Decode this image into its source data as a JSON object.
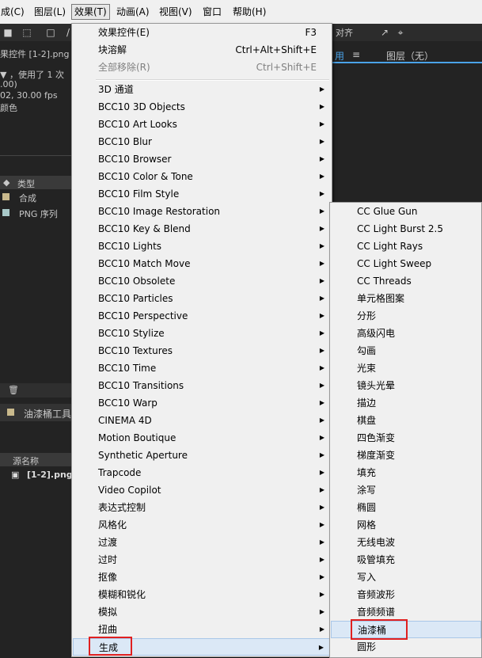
{
  "menubar": {
    "items": [
      "成(C)",
      "图层(L)",
      "效果(T)",
      "动画(A)",
      "视图(V)",
      "窗口",
      "帮助(H)"
    ],
    "active_index": 2
  },
  "toolbar": {
    "right_text": "对齐"
  },
  "left_panel": {
    "title": "果控件 [1-2].png",
    "info_line1": "▼ ，使用了 1 次",
    "info_line2": ".00)",
    "info_line3": "02, 30.00 fps",
    "info_line4": "颜色",
    "type_header": "类型",
    "row1": "合成",
    "row2": "PNG 序列",
    "comp_tab": "油漆桶工具",
    "source_header": "源名称",
    "source_row": "[1-2].png"
  },
  "right_panel": {
    "tab_label": "用",
    "layer_label": "图层（无）"
  },
  "main_menu": {
    "top_items": [
      {
        "label": "效果控件(E)",
        "shortcut": "F3",
        "disabled": false
      },
      {
        "label": "块溶解",
        "shortcut": "Ctrl+Alt+Shift+E",
        "disabled": false
      },
      {
        "label": "全部移除(R)",
        "shortcut": "Ctrl+Shift+E",
        "disabled": true
      }
    ],
    "submenu_items": [
      "3D 通道",
      "BCC10 3D Objects",
      "BCC10 Art Looks",
      "BCC10 Blur",
      "BCC10 Browser",
      "BCC10 Color & Tone",
      "BCC10 Film Style",
      "BCC10 Image Restoration",
      "BCC10 Key & Blend",
      "BCC10 Lights",
      "BCC10 Match Move",
      "BCC10 Obsolete",
      "BCC10 Particles",
      "BCC10 Perspective",
      "BCC10 Stylize",
      "BCC10 Textures",
      "BCC10 Time",
      "BCC10 Transitions",
      "BCC10 Warp",
      "CINEMA 4D",
      "Motion Boutique",
      "Synthetic Aperture",
      "Trapcode",
      "Video Copilot",
      "表达式控制",
      "风格化",
      "过渡",
      "过时",
      "抠像",
      "模糊和锐化",
      "模拟",
      "扭曲",
      "生成"
    ],
    "highlighted_label": "生成"
  },
  "generate_submenu": {
    "items": [
      "CC Glue Gun",
      "CC Light Burst 2.5",
      "CC Light Rays",
      "CC Light Sweep",
      "CC Threads",
      "单元格图案",
      "分形",
      "高级闪电",
      "勾画",
      "光束",
      "镜头光晕",
      "描边",
      "棋盘",
      "四色渐变",
      "梯度渐变",
      "填充",
      "涂写",
      "椭圆",
      "网格",
      "无线电波",
      "吸管填充",
      "写入",
      "音频波形",
      "音频频谱",
      "油漆桶",
      "圆形"
    ],
    "highlighted_label": "油漆桶"
  },
  "colors": {
    "menu_bg": "#f0f0f0",
    "highlight": "#dbe8f6",
    "red_box": "#e02020",
    "dark_bg": "#232323"
  }
}
